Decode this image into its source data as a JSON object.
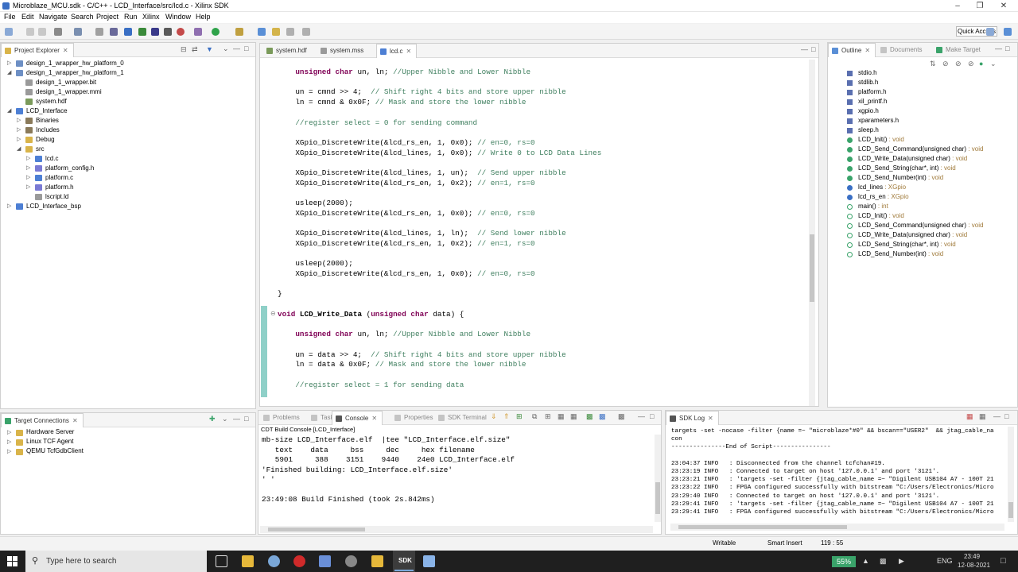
{
  "window": {
    "title": "Microblaze_MCU.sdk - C/C++ - LCD_Interface/src/lcd.c - Xilinx SDK"
  },
  "menu": [
    "File",
    "Edit",
    "Navigate",
    "Search",
    "Project",
    "Run",
    "Xilinx",
    "Window",
    "Help"
  ],
  "toolbar": {
    "quick_access": "Quick Access"
  },
  "project_explorer": {
    "tab": "Project Explorer",
    "items": [
      {
        "label": "design_1_wrapper_hw_platform_0",
        "indent": 0,
        "arrow": "▷",
        "color": "#6d8fc4"
      },
      {
        "label": "design_1_wrapper_hw_platform_1",
        "indent": 0,
        "arrow": "◢",
        "color": "#6d8fc4"
      },
      {
        "label": "design_1_wrapper.bit",
        "indent": 1,
        "arrow": "",
        "color": "#9a9a9a"
      },
      {
        "label": "design_1_wrapper.mmi",
        "indent": 1,
        "arrow": "",
        "color": "#9a9a9a"
      },
      {
        "label": "system.hdf",
        "indent": 1,
        "arrow": "",
        "color": "#7a9a5a"
      },
      {
        "label": "LCD_Interface",
        "indent": 0,
        "arrow": "◢",
        "color": "#4d7fd4"
      },
      {
        "label": "Binaries",
        "indent": 1,
        "arrow": "▷",
        "color": "#8a7a5a"
      },
      {
        "label": "Includes",
        "indent": 1,
        "arrow": "▷",
        "color": "#8a7a5a"
      },
      {
        "label": "Debug",
        "indent": 1,
        "arrow": "▷",
        "color": "#d9b44a"
      },
      {
        "label": "src",
        "indent": 1,
        "arrow": "◢",
        "color": "#d9b44a"
      },
      {
        "label": "lcd.c",
        "indent": 2,
        "arrow": "▷",
        "color": "#4d7fd4"
      },
      {
        "label": "platform_config.h",
        "indent": 2,
        "arrow": "▷",
        "color": "#7a7ad4"
      },
      {
        "label": "platform.c",
        "indent": 2,
        "arrow": "▷",
        "color": "#4d7fd4"
      },
      {
        "label": "platform.h",
        "indent": 2,
        "arrow": "▷",
        "color": "#7a7ad4"
      },
      {
        "label": "lscript.ld",
        "indent": 2,
        "arrow": "",
        "color": "#9a9a9a"
      },
      {
        "label": "LCD_Interface_bsp",
        "indent": 0,
        "arrow": "▷",
        "color": "#4d7fd4"
      }
    ]
  },
  "editor_tabs": [
    {
      "label": "system.hdf",
      "active": false
    },
    {
      "label": "system.mss",
      "active": false
    },
    {
      "label": "lcd.c",
      "active": true
    }
  ],
  "code_lines": [
    [
      [
        "    ",
        ""
      ],
      [
        "unsigned char",
        "kw"
      ],
      [
        " un, ln; ",
        ""
      ],
      [
        "//Upper Nibble and Lower Nibble",
        "cm"
      ]
    ],
    [
      [
        "",
        ""
      ]
    ],
    [
      [
        "    un = cmnd >> 4;  ",
        ""
      ],
      [
        "// Shift right 4 bits and store upper nibble",
        "cm"
      ]
    ],
    [
      [
        "    ln = cmnd & 0x0F; ",
        ""
      ],
      [
        "// Mask and store the lower nibble",
        "cm"
      ]
    ],
    [
      [
        "",
        ""
      ]
    ],
    [
      [
        "    ",
        ""
      ],
      [
        "//register select = 0 for sending command",
        "cm"
      ]
    ],
    [
      [
        "",
        ""
      ]
    ],
    [
      [
        "    XGpio_DiscreteWrite(&lcd_rs_en, 1, 0x0); ",
        ""
      ],
      [
        "// en=0, rs=0",
        "cm"
      ]
    ],
    [
      [
        "    XGpio_DiscreteWrite(&lcd_lines, 1, 0x0); ",
        ""
      ],
      [
        "// Write 0 to LCD Data Lines",
        "cm"
      ]
    ],
    [
      [
        "",
        ""
      ]
    ],
    [
      [
        "    XGpio_DiscreteWrite(&lcd_lines, 1, un);  ",
        ""
      ],
      [
        "// Send upper nibble",
        "cm"
      ]
    ],
    [
      [
        "    XGpio_DiscreteWrite(&lcd_rs_en, 1, 0x2); ",
        ""
      ],
      [
        "// en=1, rs=0",
        "cm"
      ]
    ],
    [
      [
        "",
        ""
      ]
    ],
    [
      [
        "    usleep(2000);",
        ""
      ]
    ],
    [
      [
        "    XGpio_DiscreteWrite(&lcd_rs_en, 1, 0x0); ",
        ""
      ],
      [
        "// en=0, rs=0",
        "cm"
      ]
    ],
    [
      [
        "",
        ""
      ]
    ],
    [
      [
        "    XGpio_DiscreteWrite(&lcd_lines, 1, ln);  ",
        ""
      ],
      [
        "// Send lower nibble",
        "cm"
      ]
    ],
    [
      [
        "    XGpio_DiscreteWrite(&lcd_rs_en, 1, 0x2); ",
        ""
      ],
      [
        "// en=1, rs=0",
        "cm"
      ]
    ],
    [
      [
        "",
        ""
      ]
    ],
    [
      [
        "    usleep(2000);",
        ""
      ]
    ],
    [
      [
        "    XGpio_DiscreteWrite(&lcd_rs_en, 1, 0x0); ",
        ""
      ],
      [
        "// en=0, rs=0",
        "cm"
      ]
    ],
    [
      [
        "",
        ""
      ]
    ],
    [
      [
        "}",
        ""
      ]
    ],
    [
      [
        "",
        ""
      ]
    ],
    [
      [
        "void",
        "kw"
      ],
      [
        " ",
        ""
      ],
      [
        "LCD_Write_Data",
        "fn"
      ],
      [
        " (",
        ""
      ],
      [
        "unsigned char",
        "kw"
      ],
      [
        " data) {",
        ""
      ]
    ],
    [
      [
        "",
        ""
      ]
    ],
    [
      [
        "    ",
        ""
      ],
      [
        "unsigned char",
        "kw"
      ],
      [
        " un, ln; ",
        ""
      ],
      [
        "//Upper Nibble and Lower Nibble",
        "cm"
      ]
    ],
    [
      [
        "",
        ""
      ]
    ],
    [
      [
        "    un = data >> 4;  ",
        ""
      ],
      [
        "// Shift right 4 bits and store upper nibble",
        "cm"
      ]
    ],
    [
      [
        "    ln = data & 0x0F; ",
        ""
      ],
      [
        "// Mask and store the lower nibble",
        "cm"
      ]
    ],
    [
      [
        "",
        ""
      ]
    ],
    [
      [
        "    ",
        ""
      ],
      [
        "//register select = 1 for sending data",
        "cm"
      ]
    ]
  ],
  "outline": {
    "tabs": [
      "Outline",
      "Documents",
      "Make Target"
    ],
    "items": [
      {
        "label": "stdio.h",
        "type": "",
        "kind": "inc"
      },
      {
        "label": "stdlib.h",
        "type": "",
        "kind": "inc"
      },
      {
        "label": "platform.h",
        "type": "",
        "kind": "inc"
      },
      {
        "label": "xil_printf.h",
        "type": "",
        "kind": "inc"
      },
      {
        "label": "xgpio.h",
        "type": "",
        "kind": "inc"
      },
      {
        "label": "xparameters.h",
        "type": "",
        "kind": "inc"
      },
      {
        "label": "sleep.h",
        "type": "",
        "kind": "inc"
      },
      {
        "label": "LCD_Init()",
        "type": " : void",
        "kind": "fn"
      },
      {
        "label": "LCD_Send_Command(unsigned char)",
        "type": " : void",
        "kind": "fn"
      },
      {
        "label": "LCD_Write_Data(unsigned char)",
        "type": " : void",
        "kind": "fn"
      },
      {
        "label": "LCD_Send_String(char*, int)",
        "type": " : void",
        "kind": "fn"
      },
      {
        "label": "LCD_Send_Number(int)",
        "type": " : void",
        "kind": "fn"
      },
      {
        "label": "lcd_lines",
        "type": " : XGpio",
        "kind": "var"
      },
      {
        "label": "lcd_rs_en",
        "type": " : XGpio",
        "kind": "var"
      },
      {
        "label": "main()",
        "type": " : int",
        "kind": "fnf"
      },
      {
        "label": "LCD_Init()",
        "type": " : void",
        "kind": "fnf"
      },
      {
        "label": "LCD_Send_Command(unsigned char)",
        "type": " : void",
        "kind": "fnf"
      },
      {
        "label": "LCD_Write_Data(unsigned char)",
        "type": " : void",
        "kind": "fnf"
      },
      {
        "label": "LCD_Send_String(char*, int)",
        "type": " : void",
        "kind": "fnf"
      },
      {
        "label": "LCD_Send_Number(int)",
        "type": " : void",
        "kind": "fnf"
      }
    ]
  },
  "target_connections": {
    "tab": "Target Connections",
    "items": [
      "Hardware Server",
      "Linux TCF Agent",
      "QEMU TcfGdbClient"
    ]
  },
  "console": {
    "tabs": [
      "Problems",
      "Tasks",
      "Console",
      "Properties",
      "SDK Terminal"
    ],
    "header": "CDT Build Console [LCD_Interface]",
    "lines": [
      "mb-size LCD_Interface.elf  |tee \"LCD_Interface.elf.size\"",
      "   text    data     bss     dec     hex filename",
      "   5901     388    3151    9440    24e0 LCD_Interface.elf",
      "'Finished building: LCD_Interface.elf.size'",
      "' '",
      "",
      "23:49:08 Build Finished (took 2s.842ms)"
    ]
  },
  "sdk_log": {
    "tab": "SDK Log",
    "lines": [
      "targets -set -nocase -filter {name =~ \"microblaze*#0\" && bscan==\"USER2\"  && jtag_cable_na",
      "con",
      "---------------End of Script----------------",
      "",
      "23:04:37 INFO   : Disconnected from the channel tcfchan#19.",
      "23:23:19 INFO   : Connected to target on host '127.0.0.1' and port '3121'.",
      "23:23:21 INFO   : 'targets -set -filter {jtag_cable_name =~ \"Digilent USB104 A7 - 100T 21",
      "23:23:22 INFO   : FPGA configured successfully with bitstream \"C:/Users/Electronics/Micro",
      "23:29:40 INFO   : Connected to target on host '127.0.0.1' and port '3121'.",
      "23:29:41 INFO   : 'targets -set -filter {jtag_cable_name =~ \"Digilent USB104 A7 - 100T 21",
      "23:29:41 INFO   : FPGA configured successfully with bitstream \"C:/Users/Electronics/Micro"
    ]
  },
  "status": {
    "writable": "Writable",
    "insert": "Smart Insert",
    "position": "119 : 55"
  },
  "taskbar": {
    "search": "Type here to search",
    "battery": "55%",
    "lang": "ENG",
    "time": "23:49",
    "date": "12-08-2021"
  }
}
